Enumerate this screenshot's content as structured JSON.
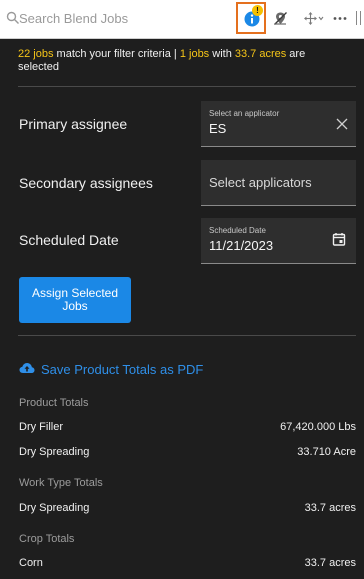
{
  "search": {
    "placeholder": "Search Blend Jobs"
  },
  "toolbar": {
    "info_badge": "!",
    "icons": [
      "search-icon",
      "info-icon",
      "map-pin-off-icon",
      "move-icon",
      "more-icon"
    ]
  },
  "summary": {
    "match_count": "22 jobs",
    "match_text": " match your filter criteria | ",
    "selected_count": "1 jobs",
    "with_text": " with ",
    "acres": "33.7 acres",
    "tail_text": " are selected"
  },
  "form": {
    "primary_label": "Primary assignee",
    "primary_field_label": "Select an applicator",
    "primary_value": "ES",
    "secondary_label": "Secondary assignees",
    "secondary_placeholder": "Select applicators",
    "date_label": "Scheduled Date",
    "date_field_label": "Scheduled Date",
    "date_value": "11/21/2023",
    "assign_button": "Assign Selected Jobs"
  },
  "pdf_link": "Save Product Totals as PDF",
  "totals": {
    "product_header": "Product Totals",
    "products": [
      {
        "name": "Dry Filler",
        "value": "67,420.000 Lbs"
      },
      {
        "name": "Dry Spreading",
        "value": "33.710 Acre"
      }
    ],
    "work_header": "Work Type Totals",
    "work_types": [
      {
        "name": "Dry Spreading",
        "value": "33.7 acres"
      }
    ],
    "crop_header": "Crop Totals",
    "crops": [
      {
        "name": "Corn",
        "value": "33.7 acres"
      }
    ]
  },
  "colors": {
    "accent_blue": "#1b88e6",
    "highlight_yellow": "#f5c518",
    "focus_orange": "#e4701e",
    "background": "#1e1e1e"
  }
}
